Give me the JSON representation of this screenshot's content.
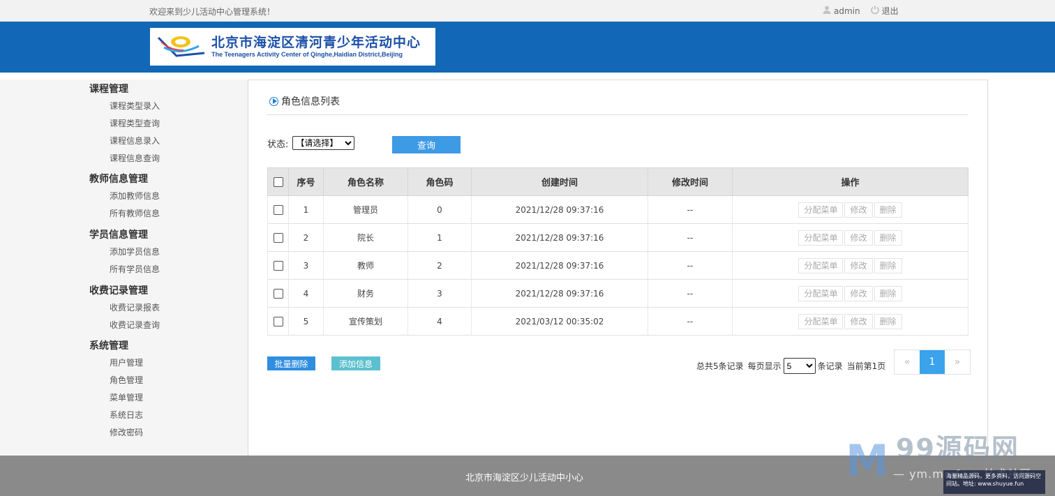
{
  "topbar": {
    "welcome": "欢迎来到少儿活动中心管理系统！",
    "user": "admin",
    "logout": "退出"
  },
  "logo": {
    "cn": "北京市海淀区清河青少年活动中心",
    "en": "The Teenagers Activity Center of Qinghe,Haidian District,Beijing"
  },
  "sidebar": {
    "groups": [
      {
        "title": "课程管理",
        "items": [
          "课程类型录入",
          "课程类型查询",
          "课程信息录入",
          "课程信息查询"
        ]
      },
      {
        "title": "教师信息管理",
        "items": [
          "添加教师信息",
          "所有教师信息"
        ]
      },
      {
        "title": "学员信息管理",
        "items": [
          "添加学员信息",
          "所有学员信息"
        ]
      },
      {
        "title": "收费记录管理",
        "items": [
          "收费记录报表",
          "收费记录查询"
        ]
      },
      {
        "title": "系统管理",
        "items": [
          "用户管理",
          "角色管理",
          "菜单管理",
          "系统日志",
          "修改密码"
        ]
      }
    ]
  },
  "main": {
    "title": "角色信息列表",
    "filter": {
      "label": "状态:",
      "selected": "【请选择】",
      "query_button": "查询"
    },
    "table": {
      "headers": [
        "序号",
        "角色名称",
        "角色码",
        "创建时间",
        "修改时间",
        "操作"
      ],
      "rows": [
        {
          "no": "1",
          "name": "管理员",
          "code": "0",
          "created": "2021/12/28 09:37:16",
          "modified": "--"
        },
        {
          "no": "2",
          "name": "院长",
          "code": "1",
          "created": "2021/12/28 09:37:16",
          "modified": "--"
        },
        {
          "no": "3",
          "name": "教师",
          "code": "2",
          "created": "2021/12/28 09:37:16",
          "modified": "--"
        },
        {
          "no": "4",
          "name": "财务",
          "code": "3",
          "created": "2021/12/28 09:37:16",
          "modified": "--"
        },
        {
          "no": "5",
          "name": "宣传策划",
          "code": "4",
          "created": "2021/03/12 00:35:02",
          "modified": "--"
        }
      ],
      "actions": [
        "分配菜单",
        "修改",
        "删除"
      ]
    },
    "batch_delete": "批量删除",
    "add_info": "添加信息",
    "pagination": {
      "total": "总共5条记录",
      "per_page_label": "每页显示",
      "per_page": "5",
      "unit": "条记录",
      "current": "当前第1页",
      "prev": "«",
      "page": "1",
      "next": "»"
    }
  },
  "footer": {
    "text": "北京市海淀区少儿活动中小心"
  },
  "watermark": {
    "title": "99源码网",
    "sub": "— ym.mmfa.n 技术社区",
    "box": "海量精品源码，更多资料，访问源码空间站。地址: www.shuyue.fun"
  },
  "colors": {
    "banner": "#1268b6",
    "primary_button": "#3d9ae5",
    "add_button": "#5bc0cf",
    "active_page": "#3aa3ec"
  }
}
